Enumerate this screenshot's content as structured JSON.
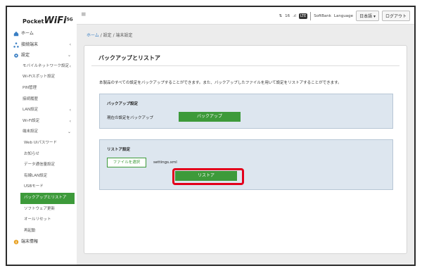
{
  "logo": {
    "prefix": "Pocket",
    "brand": "WiFi",
    "suffix": "5G"
  },
  "topbar": {
    "menu_icon": "menu-icon",
    "signal_count": "16",
    "network_badge": "LTE",
    "carrier": "SoftBank",
    "language_label": "Language",
    "language_value": "日本語 ▾",
    "logout_label": "ログアウト"
  },
  "sidebar": {
    "home": "ホーム",
    "devices": "接続端末",
    "settings": "設定",
    "mobile_network": "モバイルネットワーク設定",
    "wifi_spot": "Wi-Fiスポット設定",
    "pin": "PIN管理",
    "connection_history": "接続履歴",
    "lan_settings": "LAN設定",
    "wifi_settings": "Wi-Fi設定",
    "device_settings": "端末設定",
    "webui_password": "Web UIパスワード",
    "notifications": "お知らせ",
    "data_usage": "データ通信量設定",
    "wired_lan": "有線LAN設定",
    "usb_mode": "USBモード",
    "backup_restore": "バックアップとリストア",
    "software_update": "ソフトウェア更新",
    "all_reset": "オールリセット",
    "reboot": "再起動",
    "device_info": "端末情報"
  },
  "breadcrumb": {
    "home": "ホーム",
    "path": " / 設定 / 端末設定"
  },
  "main": {
    "title": "バックアップとリストア",
    "description": "本製品のすべての設定をバックアップすることができます。また、バックアップしたファイルを用いて設定をリストアすることができます。",
    "backup": {
      "title": "バックアップ設定",
      "label": "現在の設定をバックアップ",
      "button": "バックアップ"
    },
    "restore": {
      "title": "リストア設定",
      "file_button": "ファイルを選択",
      "file_name": "settings.xml",
      "button": "リストア"
    }
  },
  "colors": {
    "accent": "#3d9a3a",
    "highlight": "#e3001b",
    "panel": "#dde6ef"
  }
}
